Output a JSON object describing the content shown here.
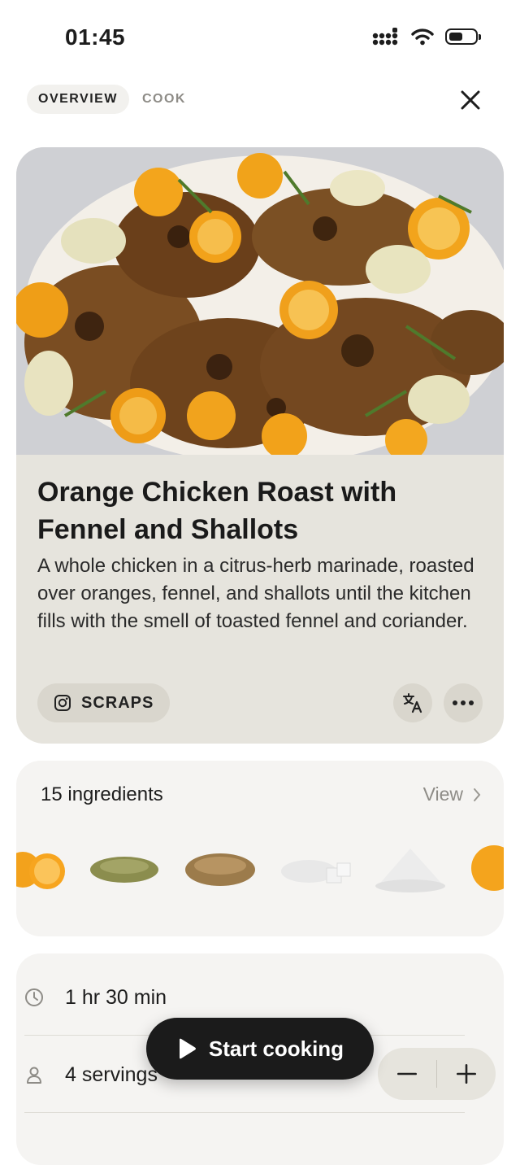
{
  "status_bar": {
    "time": "01:45"
  },
  "header": {
    "tabs": [
      {
        "label": "OVERVIEW",
        "active": true
      },
      {
        "label": "COOK",
        "active": false
      }
    ],
    "close_icon": "close-icon"
  },
  "recipe": {
    "title": "Orange Chicken Roast with Fennel and Shallots",
    "description": "A whole chicken in a citrus-herb marinade, roasted over oranges, fennel, and shallots until the kitchen fills with the smell of toasted fennel and coriander.",
    "source_label": "SCRAPS",
    "source_icon": "instagram-icon"
  },
  "ingredients": {
    "count_label": "15 ingredients",
    "view_label": "View",
    "thumbnails": [
      "orange",
      "fennel-seeds",
      "coriander-seeds",
      "sugar-cubes",
      "salt",
      "orange"
    ]
  },
  "details": {
    "time_label": "1 hr 30 min",
    "servings_label": "4 servings"
  },
  "actions": {
    "start_label": "Start cooking"
  },
  "colors": {
    "card_bg": "#e6e4dd",
    "panel_bg": "#f5f4f2",
    "primary_button": "#1b1b1b",
    "muted_text": "#8e8c87"
  }
}
